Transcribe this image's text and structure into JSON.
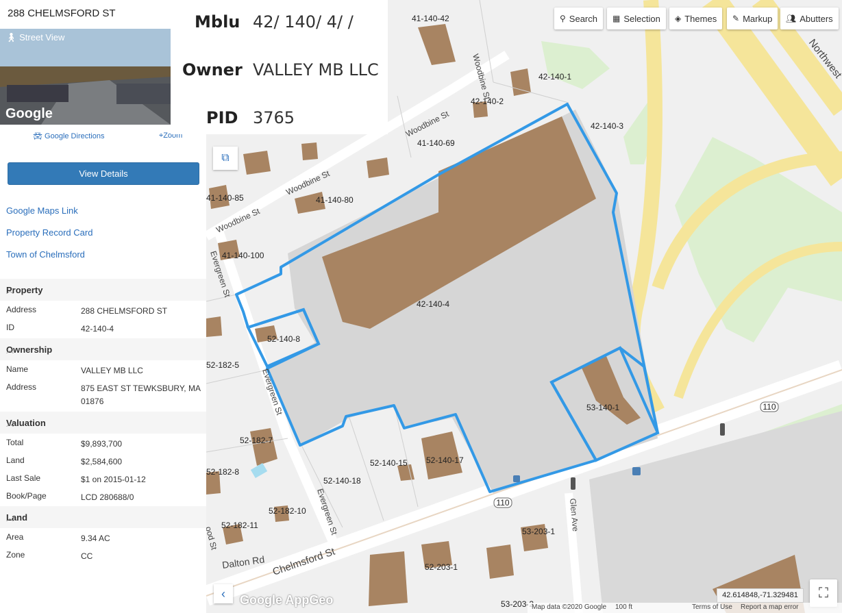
{
  "panel": {
    "title": "288 CHELMSFORD ST",
    "street_view_label": "Street View",
    "street_view_logo": "Google",
    "directions_label": "Google Directions",
    "zoom_label": "Zoom",
    "view_details_label": "View Details",
    "links": [
      "Google Maps Link",
      "Property Record Card",
      "Town of Chelmsford"
    ],
    "sections": {
      "property": {
        "label": "Property",
        "rows": [
          {
            "k": "Address",
            "v": "288 CHELMSFORD ST"
          },
          {
            "k": "ID",
            "v": "42-140-4"
          }
        ]
      },
      "ownership": {
        "label": "Ownership",
        "rows": [
          {
            "k": "Name",
            "v": "VALLEY MB LLC"
          },
          {
            "k": "Address",
            "v": "875 EAST ST TEWKSBURY, MA 01876"
          }
        ]
      },
      "valuation": {
        "label": "Valuation",
        "rows": [
          {
            "k": "Total",
            "v": "$9,893,700"
          },
          {
            "k": "Land",
            "v": "$2,584,600"
          },
          {
            "k": "Last Sale",
            "v": "$1 on 2015-01-12"
          },
          {
            "k": "Book/Page",
            "v": "LCD 280688/0"
          }
        ]
      },
      "land": {
        "label": "Land",
        "rows": [
          {
            "k": "Area",
            "v": "9.34 AC"
          },
          {
            "k": "Zone",
            "v": "CC"
          }
        ]
      }
    }
  },
  "popup": {
    "mblu_label": "Mblu",
    "mblu_value": "42/ 140/ 4/ /",
    "owner_label": "Owner",
    "owner_value": "VALLEY MB LLC",
    "pid_label": "PID",
    "pid_value": "3765"
  },
  "toolbar": {
    "search": "Search",
    "selection": "Selection",
    "themes": "Themes",
    "markup": "Markup",
    "abutters": "Abutters"
  },
  "map": {
    "parcel_labels": [
      "41-140-42",
      "42-140-1",
      "42-140-2",
      "42-140-3",
      "41-140-69",
      "41-140-85",
      "41-140-80",
      "41-140-100",
      "42-140-4",
      "52-140-8",
      "52-182-5",
      "53-140-1",
      "52-182-7",
      "52-140-15",
      "52-140-17",
      "52-140-18",
      "52-182-8",
      "52-182-10",
      "52-182-11",
      "53-203-1",
      "52-203-1",
      "53-203-2"
    ],
    "streets": {
      "woodbine1": "Woodbine St",
      "woodbine2": "Woodbine St",
      "woodbine3": "Woodbine St",
      "woodbine4": "Woodbine St",
      "evergreen1": "Evergreen St",
      "evergreen2": "Evergreen St",
      "evergreen3": "Evergreen St",
      "chelmsford": "Chelmsford St",
      "dalton": "Dalton Rd",
      "glen": "Glen Ave",
      "northwest": "Northwest",
      "wood": "ood St"
    },
    "route_shields": [
      "110",
      "110"
    ],
    "coords": "42.614848,-71.329481",
    "map_logo": "Google AppGeo",
    "attribution": {
      "data": "Map data ©2020 Google",
      "scale": "100 ft",
      "terms": "Terms of Use",
      "report": "Report a map error"
    }
  },
  "colors": {
    "accent": "#337ab7",
    "parcel_outline": "#3399e6",
    "building": "#a88462"
  }
}
